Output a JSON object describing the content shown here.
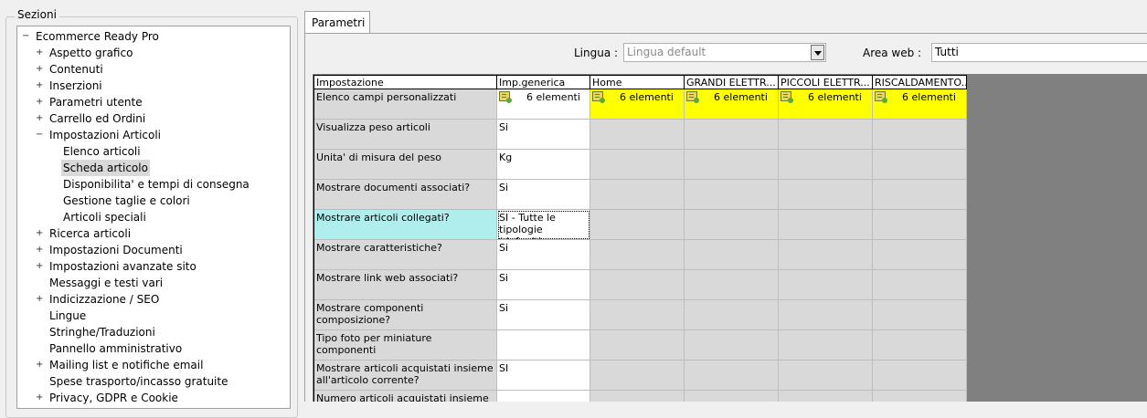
{
  "sezioni": {
    "title": "Sezioni",
    "items": [
      {
        "label": "Ecommerce Ready Pro",
        "level": 0,
        "exp": "−"
      },
      {
        "label": "Aspetto grafico",
        "level": 1,
        "exp": "+"
      },
      {
        "label": "Contenuti",
        "level": 1,
        "exp": "+"
      },
      {
        "label": "Inserzioni",
        "level": 1,
        "exp": "+"
      },
      {
        "label": "Parametri utente",
        "level": 1,
        "exp": "+"
      },
      {
        "label": "Carrello ed Ordini",
        "level": 1,
        "exp": "+"
      },
      {
        "label": "Impostazioni Articoli",
        "level": 1,
        "exp": "−"
      },
      {
        "label": "Elenco articoli",
        "level": 2,
        "exp": ""
      },
      {
        "label": "Scheda articolo",
        "level": 2,
        "exp": "",
        "selected": true
      },
      {
        "label": "Disponibilita' e tempi di consegna",
        "level": 2,
        "exp": ""
      },
      {
        "label": "Gestione taglie e colori",
        "level": 2,
        "exp": ""
      },
      {
        "label": "Articoli speciali",
        "level": 2,
        "exp": ""
      },
      {
        "label": "Ricerca articoli",
        "level": 1,
        "exp": "+"
      },
      {
        "label": "Impostazioni Documenti",
        "level": 1,
        "exp": "+"
      },
      {
        "label": "Impostazioni avanzate sito",
        "level": 1,
        "exp": "+"
      },
      {
        "label": "Messaggi e testi vari",
        "level": 1,
        "exp": ""
      },
      {
        "label": "Indicizzazione / SEO",
        "level": 1,
        "exp": "+"
      },
      {
        "label": "Lingue",
        "level": 1,
        "exp": ""
      },
      {
        "label": "Stringhe/Traduzioni",
        "level": 1,
        "exp": ""
      },
      {
        "label": "Pannello amministrativo",
        "level": 1,
        "exp": ""
      },
      {
        "label": "Mailing list e notifiche email",
        "level": 1,
        "exp": "+"
      },
      {
        "label": "Spese trasporto/incasso gratuite",
        "level": 1,
        "exp": ""
      },
      {
        "label": "Privacy, GDPR e Cookie",
        "level": 1,
        "exp": "+"
      }
    ]
  },
  "tab": {
    "label": "Parametri"
  },
  "filters": {
    "lingua_label": "Lingua :",
    "lingua_value": "Lingua default",
    "area_label": "Area web :",
    "area_value": "Tutti"
  },
  "grid": {
    "columns": [
      "Impostazione",
      "Imp.generica",
      "Home",
      "GRANDI ELETTR...",
      "PICCOLI ELETTR...",
      "RISCALDAMENTO..."
    ],
    "rows": [
      {
        "label": "Elenco campi personalizzati",
        "value": "6 elementi",
        "list": true,
        "others": [
          "6 elementi",
          "6 elementi",
          "6 elementi",
          "6 elementi"
        ]
      },
      {
        "label": "Visualizza peso articoli",
        "value": "Si"
      },
      {
        "label": "Unita' di misura del peso",
        "value": "Kg"
      },
      {
        "label": "Mostrare documenti associati?",
        "value": "Si"
      },
      {
        "label": "Mostrare articoli collegati?",
        "value": "SI - Tutte le tipologie (default)",
        "highlight": true
      },
      {
        "label": "Mostrare caratteristiche?",
        "value": "Si"
      },
      {
        "label": "Mostrare link web associati?",
        "value": "Si"
      },
      {
        "label": "Mostrare componenti composizione?",
        "value": "Si"
      },
      {
        "label": "Tipo foto per miniature componenti",
        "value": ""
      },
      {
        "label": "Mostrare articoli acquistati insieme all'articolo corrente?",
        "value": "SI"
      },
      {
        "label": "Numero articoli acquistati insieme",
        "value": ""
      }
    ]
  }
}
